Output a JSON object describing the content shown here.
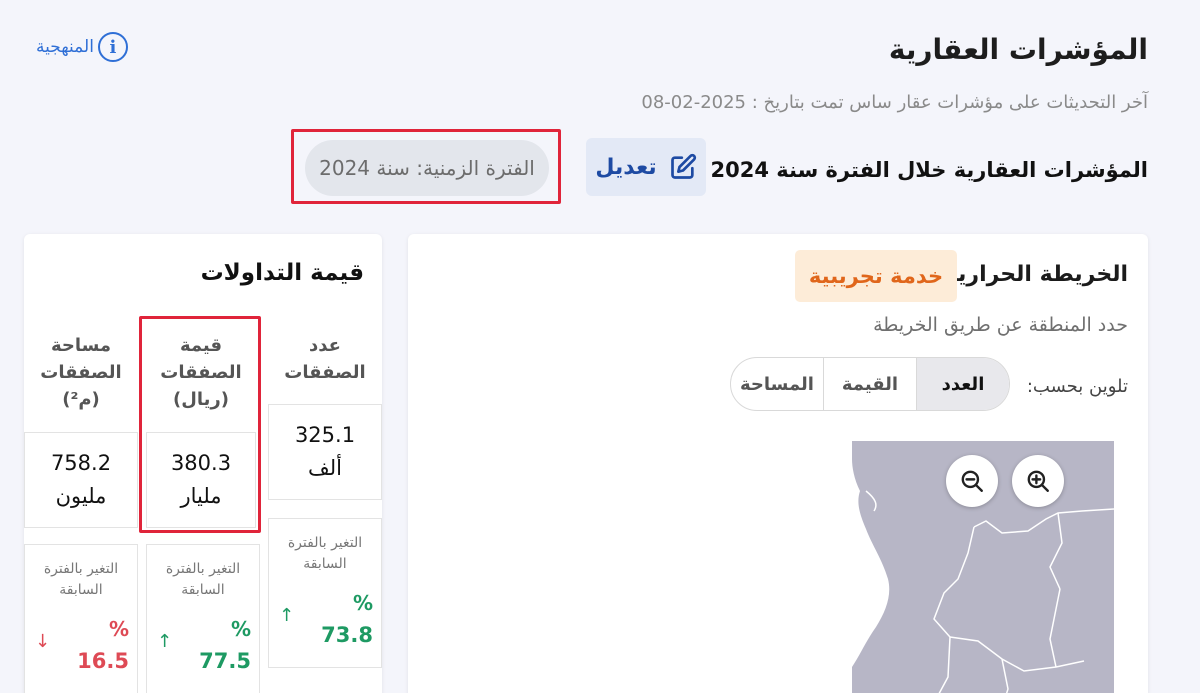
{
  "header": {
    "title": "المؤشرات العقارية",
    "methodology_label": "المنهجية",
    "last_update": "آخر التحديثات على مؤشرات عقار ساس تمت بتاريخ : 2025-02-08",
    "period_heading": "المؤشرات العقارية خلال الفترة سنة 2024",
    "edit_label": "تعديل",
    "period_pill": "الفترة الزمنية: سنة 2024"
  },
  "heatmap": {
    "title": "الخريطة الحرارية",
    "badge": "خدمة تجريبية",
    "subtitle": "حدد المنطقة عن طريق الخريطة",
    "color_by_label": "تلوين بحسب:",
    "options": [
      "العدد",
      "القيمة",
      "المساحة"
    ],
    "selected": "العدد"
  },
  "trades": {
    "title": "قيمة التداولات",
    "columns": [
      {
        "header_line1": "عدد",
        "header_line2": "الصفقات",
        "header_line3": "",
        "value_line1": "325.1",
        "value_line2": "ألف",
        "change_label_line1": "التغير بالفترة",
        "change_label_line2": "السابقة",
        "change_pct": "%",
        "change_value": "73.8",
        "direction": "up"
      },
      {
        "header_line1": "قيمة",
        "header_line2": "الصفقات",
        "header_line3": "(ريال)",
        "value_line1": "380.3",
        "value_line2": "مليار",
        "change_label_line1": "التغير بالفترة",
        "change_label_line2": "السابقة",
        "change_pct": "%",
        "change_value": "77.5",
        "direction": "up"
      },
      {
        "header_line1": "مساحة",
        "header_line2": "الصفقات",
        "header_line3": "(م²)",
        "value_line1": "758.2",
        "value_line2": "مليون",
        "change_label_line1": "التغير بالفترة",
        "change_label_line2": "السابقة",
        "change_pct": "%",
        "change_value": "16.5",
        "direction": "down"
      }
    ]
  },
  "colors": {
    "accent_blue": "#2f6fd6",
    "edit_blue": "#1d4aa3",
    "highlight_red": "#e0243a",
    "badge_orange": "#e0661b",
    "positive_green": "#1e9a63",
    "negative_red": "#de4a55",
    "map_fill": "#b7b6c6"
  }
}
